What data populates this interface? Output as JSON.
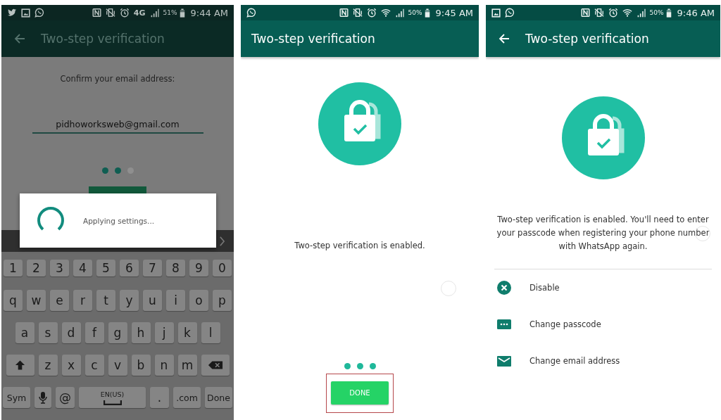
{
  "screens": [
    {
      "kind": "confirm_email",
      "dimmed": true,
      "touch_indicator": false,
      "status_bar": {
        "notification_icons": [
          {
            "kind": "bird"
          },
          {
            "kind": "image"
          },
          {
            "kind": "chat"
          }
        ],
        "system_icons": [
          {
            "kind": "nfc"
          },
          {
            "kind": "vibrate"
          },
          {
            "kind": "alarm"
          },
          {
            "kind": "network",
            "label": "4G"
          },
          {
            "kind": "signal"
          }
        ],
        "battery": "51%",
        "time": "9:44 AM"
      },
      "app_bar": {
        "back": true,
        "title": "Two-step verification"
      },
      "prompt": "Confirm your email address:",
      "email_field": {
        "value": "pidhoworksweb@gmail.com"
      },
      "page_dots": [
        {
          "filled": true
        },
        {
          "filled": true
        },
        {
          "filled": false
        }
      ],
      "dialog": {
        "message": "Applying settings..."
      },
      "keyboard": {
        "rows": [
          {
            "keys": [
              "1",
              "2",
              "3",
              "4",
              "5",
              "6",
              "7",
              "8",
              "9",
              "0"
            ]
          },
          {
            "keys": [
              "q",
              "w",
              "e",
              "r",
              "t",
              "y",
              "u",
              "i",
              "o",
              "p"
            ]
          },
          {
            "keys": [
              "a",
              "s",
              "d",
              "f",
              "g",
              "h",
              "j",
              "k",
              "l"
            ]
          },
          {
            "keys": [
              {
                "kind": "shift"
              },
              "z",
              "x",
              "c",
              "v",
              "b",
              "n",
              "m",
              {
                "kind": "backspace"
              }
            ]
          },
          {
            "keys": [
              {
                "kind": "wide",
                "label": "Sym"
              },
              {
                "kind": "mic"
              },
              "@",
              {
                "kind": "space",
                "label": "EN(US)"
              },
              ".",
              {
                "kind": "wide",
                "label": ".com"
              },
              {
                "kind": "wide",
                "label": "Done"
              }
            ]
          }
        ]
      }
    },
    {
      "kind": "enabled",
      "dimmed": false,
      "touch_indicator": true,
      "status_bar": {
        "notification_icons": [
          {
            "kind": "chat"
          }
        ],
        "system_icons": [
          {
            "kind": "nfc"
          },
          {
            "kind": "vibrate"
          },
          {
            "kind": "alarm"
          },
          {
            "kind": "wifi"
          },
          {
            "kind": "signal"
          }
        ],
        "battery": "50%",
        "time": "9:45 AM"
      },
      "app_bar": {
        "back": false,
        "title": "Two-step verification"
      },
      "message": "Two-step verification is enabled.",
      "page_dots": [
        {
          "filled": true
        },
        {
          "filled": true
        },
        {
          "filled": true
        }
      ],
      "done_button": {
        "label": "DONE",
        "highlighted": true
      }
    },
    {
      "kind": "settings",
      "dimmed": false,
      "touch_indicator": true,
      "status_bar": {
        "notification_icons": [
          {
            "kind": "image"
          },
          {
            "kind": "chat"
          }
        ],
        "system_icons": [
          {
            "kind": "nfc"
          },
          {
            "kind": "vibrate"
          },
          {
            "kind": "alarm"
          },
          {
            "kind": "wifi"
          },
          {
            "kind": "signal"
          }
        ],
        "battery": "50%",
        "time": "9:46 AM"
      },
      "app_bar": {
        "back": true,
        "title": "Two-step verification"
      },
      "message": "Two-step verification is enabled. You'll need to enter your passcode when registering your phone number with WhatsApp again.",
      "options": [
        {
          "kind": "disable",
          "label": "Disable"
        },
        {
          "kind": "passcode",
          "label": "Change passcode"
        },
        {
          "kind": "email",
          "label": "Change email address"
        }
      ]
    }
  ]
}
